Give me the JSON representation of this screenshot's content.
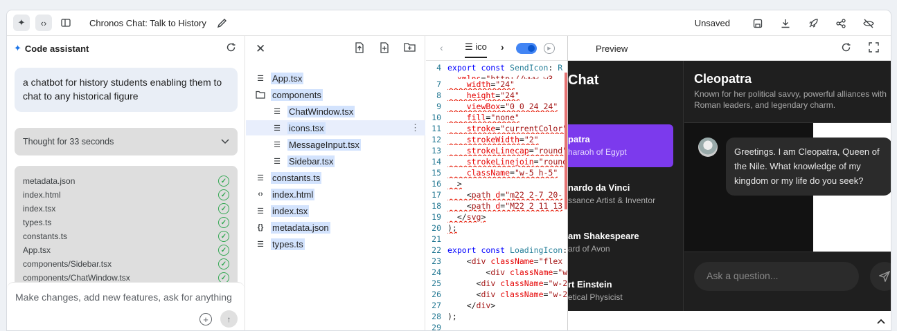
{
  "topbar": {
    "app_title": "Chronos Chat: Talk to History",
    "unsaved_label": "Unsaved"
  },
  "assistant": {
    "title": "Code assistant",
    "user_prompt": "a chatbot for history students enabling them to chat to any historical figure",
    "thought_label": "Thought for 33 seconds",
    "generated_files": [
      "metadata.json",
      "index.html",
      "index.tsx",
      "types.ts",
      "constants.ts",
      "App.tsx",
      "components/Sidebar.tsx",
      "components/ChatWindow.tsx"
    ],
    "input_placeholder": "Make changes, add new features, ask for anything"
  },
  "file_tree": {
    "items": [
      {
        "label": "App.tsx",
        "icon": "code-lines-icon"
      },
      {
        "label": "components",
        "icon": "folder-icon"
      },
      {
        "label": "ChatWindow.tsx",
        "icon": "code-lines-icon"
      },
      {
        "label": "icons.tsx",
        "icon": "code-lines-icon"
      },
      {
        "label": "MessageInput.tsx",
        "icon": "code-lines-icon"
      },
      {
        "label": "Sidebar.tsx",
        "icon": "code-lines-icon"
      },
      {
        "label": "constants.ts",
        "icon": "code-lines-icon"
      },
      {
        "label": "index.html",
        "icon": "html-tag-icon"
      },
      {
        "label": "index.tsx",
        "icon": "code-lines-icon"
      },
      {
        "label": "metadata.json",
        "icon": "json-braces-icon"
      },
      {
        "label": "types.ts",
        "icon": "code-lines-icon"
      }
    ]
  },
  "editor": {
    "tab_label": "ico",
    "line_numbers": [
      "4",
      "7",
      "8",
      "9",
      "10",
      "11",
      "12",
      "13",
      "14",
      "15",
      "16",
      "17",
      "18",
      "19",
      "20",
      "21",
      "22",
      "23",
      "24",
      "25",
      "26",
      "27",
      "28",
      "29"
    ]
  },
  "preview": {
    "title": "Preview",
    "sidebar_title": "Chat",
    "figures": [
      {
        "name": "patra",
        "desc": "haraoh of Egypt"
      },
      {
        "name": "nardo da Vinci",
        "desc": "ssance Artist & Inventor"
      },
      {
        "name": "am Shakespeare",
        "desc": "ard of Avon"
      },
      {
        "name": "rt Einstein",
        "desc": "etical Physicist"
      }
    ],
    "active_name": "Cleopatra",
    "active_desc": "Known for her political savvy, powerful alliances with Roman leaders, and legendary charm.",
    "message": "Greetings. I am Cleopatra, Queen of the Nile. What knowledge of my kingdom or my life do you seek?",
    "input_placeholder": "Ask a question..."
  }
}
